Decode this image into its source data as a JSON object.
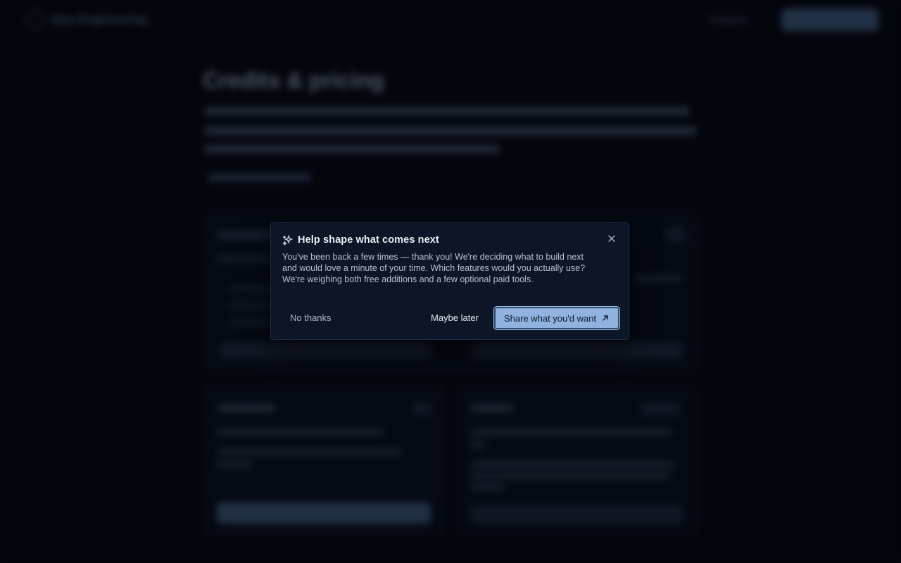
{
  "background": {
    "brand": "Idea Engineering",
    "nav_link": "Features",
    "page_title": "Credits & pricing"
  },
  "modal": {
    "title": "Help shape what comes next",
    "body": "You've been back a few times — thank you! We're deciding what to build next and would love a minute of your time. Which features would you actually use? We're weighing both free additions and a few optional paid tools.",
    "no_thanks_label": "No thanks",
    "maybe_later_label": "Maybe later",
    "share_label": "Share what you'd want",
    "icons": {
      "header": "sparkle-icon",
      "close": "close-icon",
      "share": "arrow-up-right-icon"
    }
  },
  "colors": {
    "modal_bg": "#0d1626",
    "primary_button": "#8fb3de",
    "page_bg": "#03060d"
  }
}
